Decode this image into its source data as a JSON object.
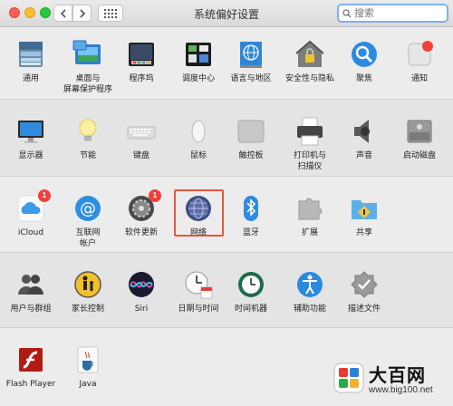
{
  "window": {
    "title": "系统偏好设置",
    "search_placeholder": "搜索"
  },
  "rows": [
    [
      {
        "name": "general",
        "label": "通用",
        "icon": "general-icon"
      },
      {
        "name": "desktop-screensaver",
        "label": "桌面与\n屏幕保护程序",
        "icon": "desktop-screensaver-icon"
      },
      {
        "name": "dock",
        "label": "程序坞",
        "icon": "dock-icon"
      },
      {
        "name": "mission-control",
        "label": "调度中心",
        "icon": "mission-control-icon"
      },
      {
        "name": "language-region",
        "label": "语言与地区",
        "icon": "globe-flag-icon"
      },
      {
        "name": "security-privacy",
        "label": "安全性与隐私",
        "icon": "house-lock-icon"
      },
      {
        "name": "spotlight",
        "label": "聚焦",
        "icon": "magnifier-icon"
      },
      {
        "name": "notifications",
        "label": "通知",
        "icon": "notifications-icon"
      }
    ],
    [
      {
        "name": "displays",
        "label": "显示器",
        "icon": "monitor-icon"
      },
      {
        "name": "energy-saver",
        "label": "节能",
        "icon": "lightbulb-icon"
      },
      {
        "name": "keyboard",
        "label": "键盘",
        "icon": "keyboard-icon"
      },
      {
        "name": "mouse",
        "label": "鼠标",
        "icon": "mouse-icon"
      },
      {
        "name": "trackpad",
        "label": "触控板",
        "icon": "trackpad-icon"
      },
      {
        "name": "printers-scanners",
        "label": "打印机与\n扫描仪",
        "icon": "printer-icon"
      },
      {
        "name": "sound",
        "label": "声音",
        "icon": "speaker-icon"
      },
      {
        "name": "startup-disk",
        "label": "启动磁盘",
        "icon": "disk-icon"
      }
    ],
    [
      {
        "name": "icloud",
        "label": "iCloud",
        "icon": "cloud-icon",
        "badge": "1"
      },
      {
        "name": "internet-accounts",
        "label": "互联网\n帐户",
        "icon": "at-sign-icon"
      },
      {
        "name": "software-update",
        "label": "软件更新",
        "icon": "gear-icon",
        "badge": "1"
      },
      {
        "name": "network",
        "label": "网络",
        "icon": "network-globe-icon",
        "selected": true
      },
      {
        "name": "bluetooth",
        "label": "蓝牙",
        "icon": "bluetooth-icon"
      },
      {
        "name": "extensions",
        "label": "扩展",
        "icon": "puzzle-icon"
      },
      {
        "name": "sharing",
        "label": "共享",
        "icon": "sharing-folder-icon"
      }
    ],
    [
      {
        "name": "users-groups",
        "label": "用户与群组",
        "icon": "users-icon"
      },
      {
        "name": "parental-controls",
        "label": "家长控制",
        "icon": "parental-controls-icon"
      },
      {
        "name": "siri",
        "label": "Siri",
        "icon": "siri-icon"
      },
      {
        "name": "date-time",
        "label": "日期与时间",
        "icon": "clock-calendar-icon"
      },
      {
        "name": "time-machine",
        "label": "时间机器",
        "icon": "time-machine-icon"
      },
      {
        "name": "accessibility",
        "label": "辅助功能",
        "icon": "accessibility-icon"
      },
      {
        "name": "profiles",
        "label": "描述文件",
        "icon": "badge-check-icon"
      }
    ],
    [
      {
        "name": "flash-player",
        "label": "Flash Player",
        "icon": "flash-icon"
      },
      {
        "name": "java",
        "label": "Java",
        "icon": "java-cup-icon"
      }
    ]
  ],
  "watermark": {
    "title": "大百网",
    "url": "www.big100.net"
  }
}
